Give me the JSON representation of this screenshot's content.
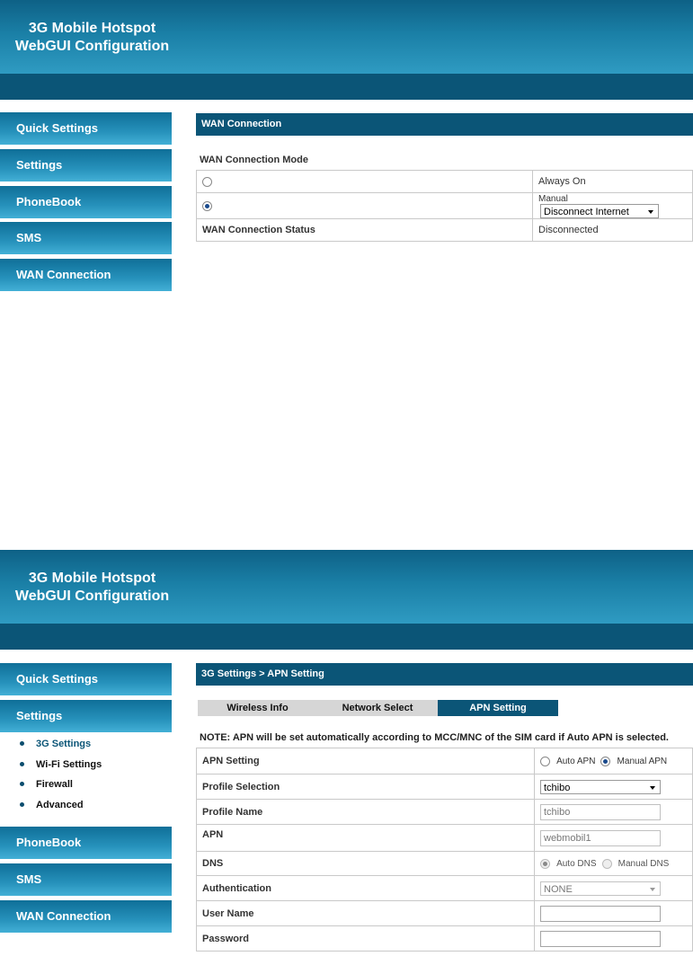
{
  "header": {
    "line1": "3G Mobile Hotspot",
    "line2": "WebGUI Configuration"
  },
  "nav": {
    "quick_settings": "Quick Settings",
    "settings": "Settings",
    "phonebook": "PhoneBook",
    "sms": "SMS",
    "wan_connection": "WAN Connection"
  },
  "settings_submenu": [
    "3G Settings",
    "Wi-Fi Settings",
    "Firewall",
    "Advanced"
  ],
  "wan": {
    "title": "WAN Connection",
    "mode_label": "WAN Connection Mode",
    "always_on": "Always On",
    "manual_label": "Manual",
    "manual_select": "Disconnect Internet",
    "status_label": "WAN Connection Status",
    "status_value": "Disconnected"
  },
  "apn": {
    "title": "3G Settings > APN Setting",
    "tabs": [
      "Wireless Info",
      "Network Select",
      "APN Setting"
    ],
    "note": "NOTE: APN will be set automatically according to MCC/MNC of the SIM card if Auto APN is selected.",
    "rows": {
      "apn_setting": "APN Setting",
      "profile_selection": "Profile Selection",
      "profile_name": "Profile Name",
      "apn": "APN",
      "dns": "DNS",
      "authentication": "Authentication",
      "user_name": "User Name",
      "password": "Password"
    },
    "auto_apn": "Auto APN",
    "manual_apn": "Manual APN",
    "profile_selection_value": "tchibo",
    "profile_name_value": "tchibo",
    "apn_value": "webmobil1",
    "auto_dns": "Auto DNS",
    "manual_dns": "Manual DNS",
    "authentication_value": "NONE",
    "user_name_value": "",
    "password_value": ""
  }
}
